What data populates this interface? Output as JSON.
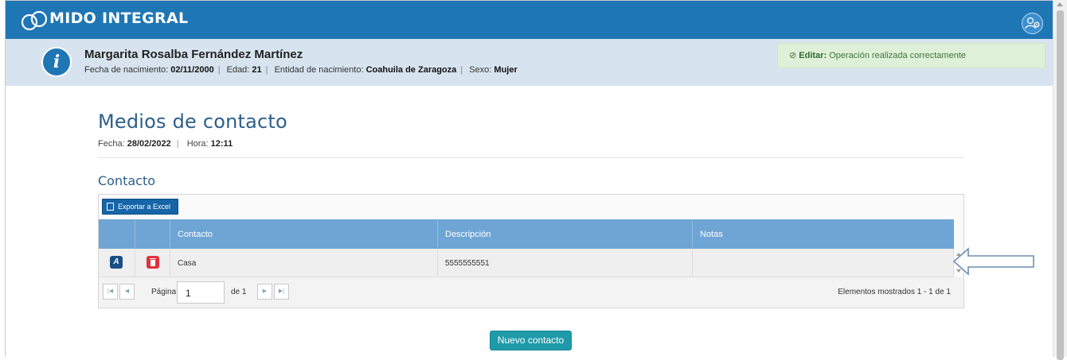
{
  "app": {
    "brand": "MIDO INTEGRAL",
    "accent": "#1f76b5"
  },
  "header": {
    "user_icon": "user-settings-icon"
  },
  "patient": {
    "name": "Margarita Rosalba Fernández Martínez",
    "birth_label": "Fecha de nacimiento:",
    "birth_value": "02/11/2000",
    "age_label": "Edad:",
    "age_value": "21",
    "entity_label": "Entidad de nacimiento:",
    "entity_value": "Coahuila de Zaragoza",
    "sex_label": "Sexo:",
    "sex_value": "Mujer"
  },
  "toast": {
    "title": "Editar:",
    "message": "Operación realizada correctamente",
    "color": "#dff0d8"
  },
  "page": {
    "title": "Medios de contacto",
    "date_label": "Fecha:",
    "date_value": "28/02/2022",
    "time_label": "Hora:",
    "time_value": "12:11",
    "section_title": "Contacto"
  },
  "grid": {
    "export_label": "Exportar a Excel",
    "columns": [
      "Contacto",
      "Descripción",
      "Notas"
    ],
    "rows": [
      {
        "contacto": "Casa",
        "descripcion": "5555555551",
        "notas": ""
      }
    ]
  },
  "pager": {
    "page_label": "Página",
    "page_value": "1",
    "of_label": "de 1",
    "info": "Elementos mostrados 1 - 1 de 1"
  },
  "actions": {
    "new_contact": "Nuevo contacto",
    "new_contact_color": "#1f9aa9"
  }
}
